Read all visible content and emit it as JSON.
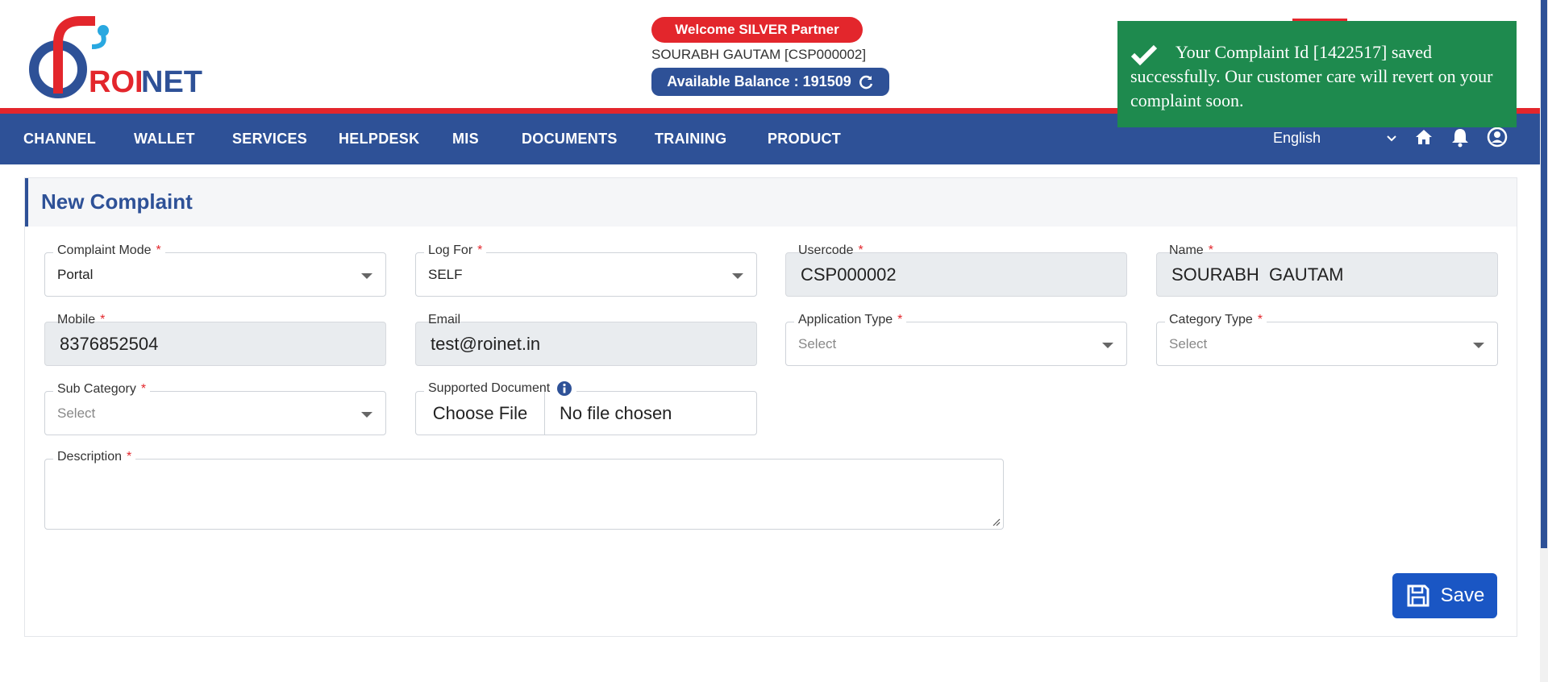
{
  "header": {
    "logo_text": "ROINET",
    "welcome": "Welcome SILVER Partner",
    "user": "SOURABH GAUTAM [CSP000002]",
    "balance_label": "Available Balance : 191509"
  },
  "nav": {
    "items": [
      "CHANNEL",
      "WALLET",
      "SERVICES",
      "HELPDESK",
      "MIS",
      "DOCUMENTS",
      "TRAINING",
      "PRODUCT"
    ],
    "language": "English",
    "icons": [
      "home-icon",
      "bell-icon",
      "user-circle-icon"
    ]
  },
  "toast": {
    "message": "Your Complaint Id [1422517] saved successfully. Our customer care will revert on your complaint soon.",
    "color": "#1e8a4e"
  },
  "form": {
    "title": "New Complaint",
    "complaint_mode": {
      "label": "Complaint Mode",
      "value": "Portal"
    },
    "log_for": {
      "label": "Log For",
      "value": "SELF"
    },
    "usercode": {
      "label": "Usercode",
      "value": "CSP000002"
    },
    "name": {
      "label": "Name",
      "value": "SOURABH  GAUTAM"
    },
    "mobile": {
      "label": "Mobile",
      "value": "8376852504"
    },
    "email": {
      "label": "Email",
      "value": "test@roinet.in"
    },
    "application_type": {
      "label": "Application Type",
      "placeholder": "Select"
    },
    "category_type": {
      "label": "Category Type",
      "placeholder": "Select"
    },
    "sub_category": {
      "label": "Sub Category",
      "placeholder": "Select"
    },
    "supported_document": {
      "label": "Supported Document",
      "button": "Choose File",
      "status": "No file chosen"
    },
    "description": {
      "label": "Description",
      "value": ""
    },
    "required_mark": "*",
    "save_label": "Save"
  },
  "colors": {
    "brand_blue": "#2e5197",
    "brand_red": "#e3262c",
    "save_blue": "#1a56c4"
  }
}
